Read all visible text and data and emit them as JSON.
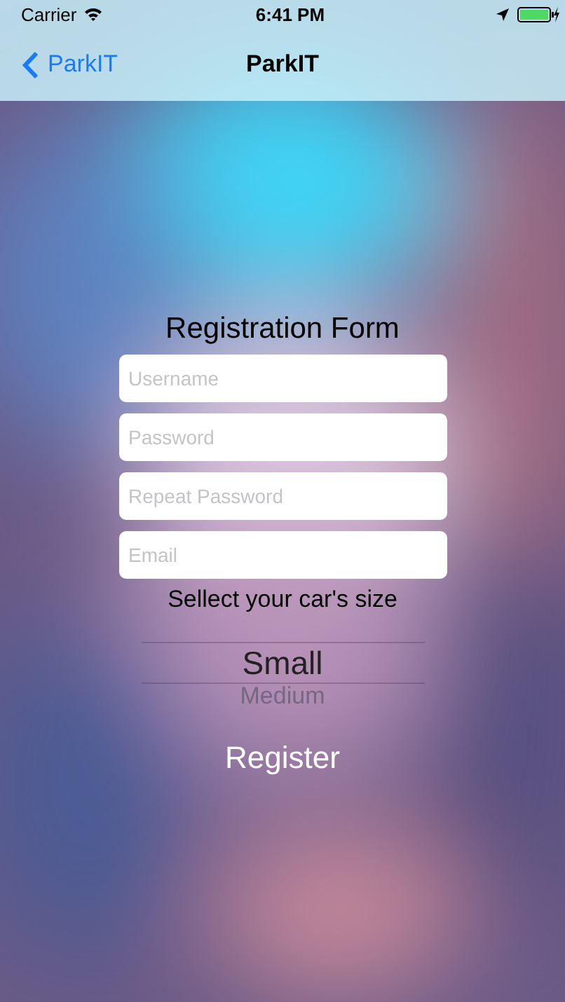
{
  "status_bar": {
    "carrier": "Carrier",
    "time": "6:41 PM",
    "battery_charging": true
  },
  "nav_bar": {
    "back": "ParkIT",
    "title": "ParkIT"
  },
  "form": {
    "title": "Registration Form",
    "fields": [
      {
        "placeholder": "Username"
      },
      {
        "placeholder": "Password"
      },
      {
        "placeholder": "Repeat Password"
      },
      {
        "placeholder": "Email"
      }
    ],
    "picker_label": "Sellect your car's size",
    "picker_options": [
      {
        "label": "Small",
        "selected": true
      },
      {
        "label": "Medium",
        "selected": false
      }
    ],
    "submit": "Register"
  }
}
